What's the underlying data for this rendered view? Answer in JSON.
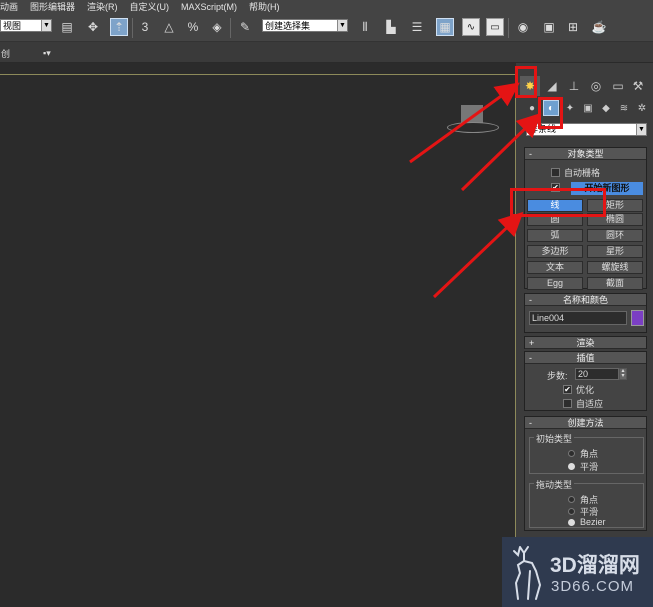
{
  "menubar": {
    "items": [
      "动画",
      "图形编辑器",
      "渲染(R)",
      "自定义(U)",
      "MAXScript(M)",
      "帮助(H)"
    ]
  },
  "toolbar": {
    "view_select": "视图",
    "selection_set": "创建选择集",
    "snap_3": "3",
    "snap_percent": "%"
  },
  "subbar": {
    "label": "创"
  },
  "command_panel": {
    "tabs": [
      "create-icon",
      "modify-icon",
      "hierarchy-icon",
      "motion-icon",
      "display-icon",
      "utilities-icon"
    ],
    "subtabs": [
      "geometry-icon",
      "shapes-icon",
      "lights-icon",
      "cameras-icon",
      "helpers-icon",
      "spacewarps-icon",
      "systems-icon"
    ],
    "category_value": "样条线",
    "object_type": {
      "title": "对象类型",
      "auto_grid": "自动栅格",
      "start_new_shape": "开始新图形",
      "buttons": [
        "线",
        "矩形",
        "圆",
        "椭圆",
        "弧",
        "圆环",
        "多边形",
        "星形",
        "文本",
        "螺旋线",
        "Egg",
        "截面"
      ],
      "selected_button": "线"
    },
    "name_color": {
      "title": "名称和颜色",
      "name": "Line004",
      "color": "#7b3fc4"
    },
    "rendering": {
      "title": "渲染",
      "sign": "+"
    },
    "interpolation": {
      "title": "插值",
      "steps_label": "步数:",
      "steps_value": "20",
      "optimize": "优化",
      "adaptive": "自适应"
    },
    "creation_method": {
      "title": "创建方法",
      "initial_type": {
        "title": "初始类型",
        "options": [
          "角点",
          "平滑"
        ],
        "selected": "平滑"
      },
      "drag_type": {
        "title": "拖动类型",
        "options": [
          "角点",
          "平滑",
          "Bezier"
        ],
        "selected": "Bezier"
      }
    }
  },
  "watermark": {
    "line1": "3D溜溜网",
    "line2": "3D66.COM"
  },
  "colors": {
    "accent_blue": "#4a8ce0",
    "annotation_red": "#e41414",
    "panel_bg": "#3c3c3c",
    "viewport_bg": "#2b2b2b"
  }
}
